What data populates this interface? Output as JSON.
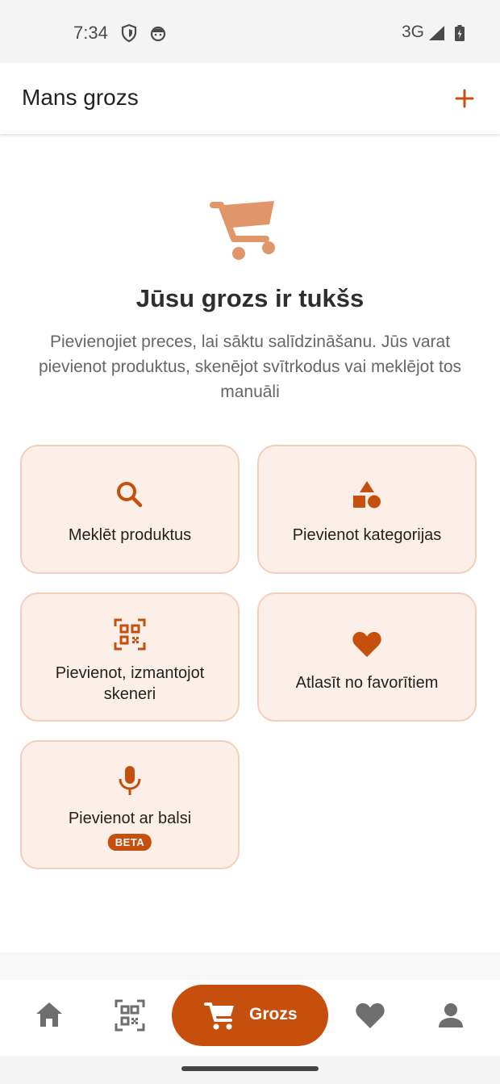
{
  "status_bar": {
    "time": "7:34",
    "network": "3G"
  },
  "app_bar": {
    "title": "Mans grozs"
  },
  "empty_state": {
    "title": "Jūsu grozs ir tukšs",
    "description": "Pievienojiet preces, lai sāktu salīdzināšanu. Jūs varat pievienot produktus, skenējot svītrkodus vai meklējot tos manuāli"
  },
  "actions": {
    "search": "Meklēt produktus",
    "categories": "Pievienot kategorijas",
    "scanner": "Pievienot, izmantojot skeneri",
    "favorites": "Atlasīt no favorītiem",
    "voice": "Pievienot ar balsi",
    "voice_badge": "BETA"
  },
  "bottom_nav": {
    "active_label": "Grozs"
  },
  "colors": {
    "accent": "#c64f0e",
    "accent_light": "#e0956a",
    "card_bg": "#fbefe8",
    "card_border": "#f3cfbb"
  },
  "icons": [
    "shield-icon",
    "face-icon",
    "signal-icon",
    "battery-icon",
    "plus-icon",
    "cart-icon",
    "search-icon",
    "shapes-icon",
    "qr-icon",
    "heart-icon",
    "mic-icon",
    "home-icon",
    "person-icon"
  ]
}
